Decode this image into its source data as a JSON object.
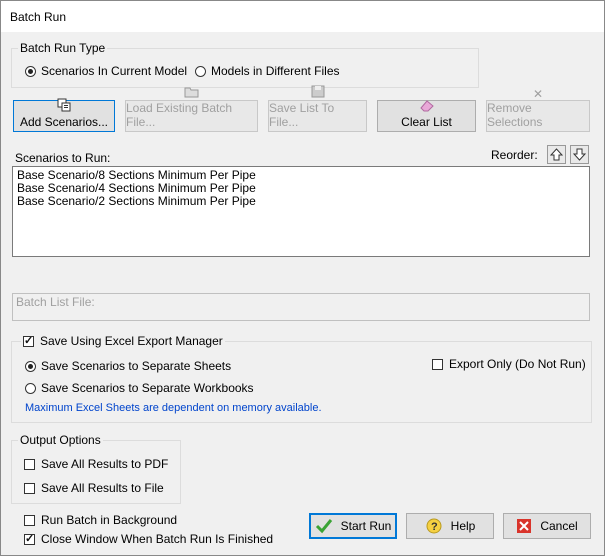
{
  "window": {
    "title": "Batch Run"
  },
  "batch_run_type": {
    "label": "Batch Run Type",
    "options": [
      "Scenarios In Current Model",
      "Models in Different Files"
    ],
    "selected": "Scenarios In Current Model"
  },
  "toolbar": {
    "add_scenarios": "Add Scenarios...",
    "load_existing": "Load Existing Batch File...",
    "save_list": "Save List To File...",
    "clear_list": "Clear List",
    "remove_selections": "Remove Selections"
  },
  "scenarios": {
    "label": "Scenarios to Run:",
    "reorder_label": "Reorder:",
    "items": [
      "Base Scenario/8 Sections Minimum Per Pipe",
      "Base Scenario/4 Sections Minimum Per Pipe",
      "Base Scenario/2 Sections Minimum Per Pipe"
    ]
  },
  "batch_list_file": {
    "label": "Batch List File:"
  },
  "excel": {
    "save_using_label": "Save Using Excel Export Manager",
    "save_using_checked": true,
    "options": [
      "Save Scenarios to Separate Sheets",
      "Save Scenarios to Separate Workbooks"
    ],
    "selected": "Save Scenarios to Separate Sheets",
    "export_only_label": "Export Only (Do Not Run)",
    "export_only_checked": false,
    "note": "Maximum Excel Sheets are dependent on memory available.",
    "note_color": "#0044cc"
  },
  "output_options": {
    "label": "Output Options",
    "pdf_label": "Save All Results to PDF",
    "file_label": "Save All Results to File"
  },
  "run_background": {
    "label": "Run Batch in Background",
    "checked": false
  },
  "close_window": {
    "label": "Close Window When Batch Run Is Finished",
    "checked": true
  },
  "buttons": {
    "start": "Start Run",
    "help": "Help",
    "cancel": "Cancel"
  }
}
